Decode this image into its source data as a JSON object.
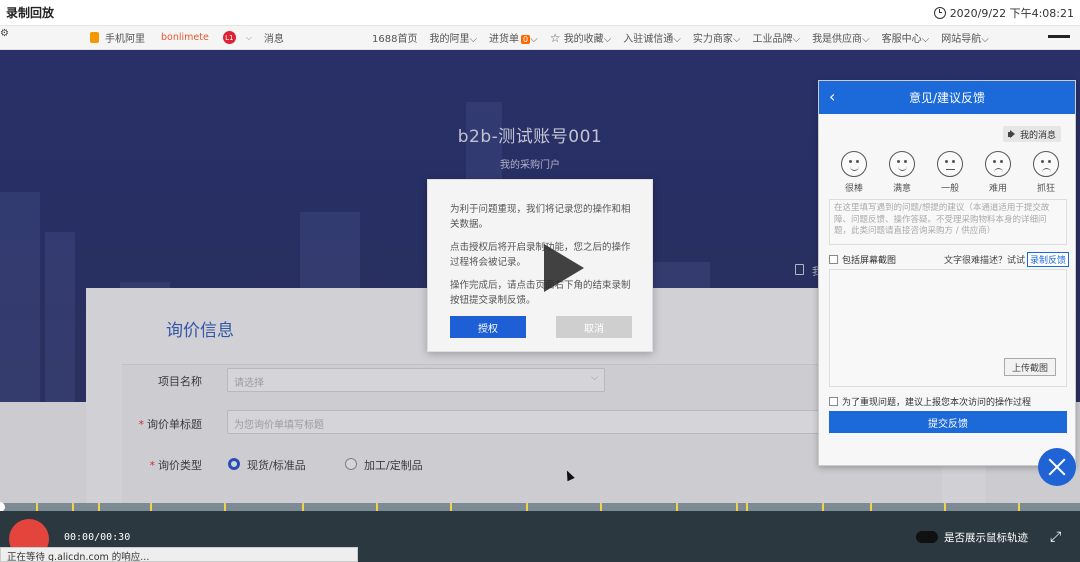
{
  "recorder": {
    "title": "录制回放",
    "datetime": "2020/9/22 下午4:08:21"
  },
  "topbar": {
    "mobile": "手机阿里",
    "brand": "bonlimete",
    "avatar": "L1",
    "message": "消息",
    "items": [
      "1688首页",
      "我的阿里",
      "进货单",
      "我的收藏",
      "入驻诚信通",
      "实力商家",
      "工业品牌",
      "我是供应商",
      "客服中心",
      "网站导航"
    ],
    "cart_count": "0"
  },
  "hero": {
    "title": "b2b-测试账号001",
    "subtitle": "我的采购门户",
    "doc_label": "我"
  },
  "form": {
    "title": "询价信息",
    "project_label": "项目名称",
    "project_placeholder": "请选择",
    "subject_label": "询价单标题",
    "subject_placeholder": "为您询价单填写标题",
    "type_label": "询价类型",
    "type_option1": "现货/标准品",
    "type_option2": "加工/定制品"
  },
  "dialog": {
    "p1": "为利于问题重现，我们将记录您的操作和相关数据。",
    "p2": "点击授权后将开启录制功能，您之后的操作过程将会被记录。",
    "p3": "操作完成后，请点击页面右下角的结束录制按钮提交录制反馈。",
    "authorize": "授权",
    "cancel": "取消"
  },
  "feedback": {
    "title": "意见/建议反馈",
    "my_messages": "我的消息",
    "faces": [
      {
        "label": "很棒"
      },
      {
        "label": "满意"
      },
      {
        "label": "一般"
      },
      {
        "label": "难用"
      },
      {
        "label": "抓狂"
      }
    ],
    "placeholder": "在这里填写遇到的问题/想提的建议（本通道适用于提交故障、问题反馈、操作答疑。不受理采购物料本身的详细问题，此类问题请直接咨询采购方 / 供应商）",
    "include_screenshot": "包括屏幕截图",
    "hint": "文字很难描述？试试",
    "record_feedback": "录制反馈",
    "upload": "上传截图",
    "reproduce_note": "为了重现问题，建议上报您本次访问的操作过程",
    "submit": "提交反馈"
  },
  "player": {
    "timecode": "00:00/00:30",
    "show_cursor_label": "是否展示鼠标轨迹",
    "status_tip": "正在等待 g.alicdn.com 的响应..."
  },
  "colors": {
    "accent": "#1c6ad9",
    "record": "#e3453d",
    "hero": "#2d3675"
  }
}
